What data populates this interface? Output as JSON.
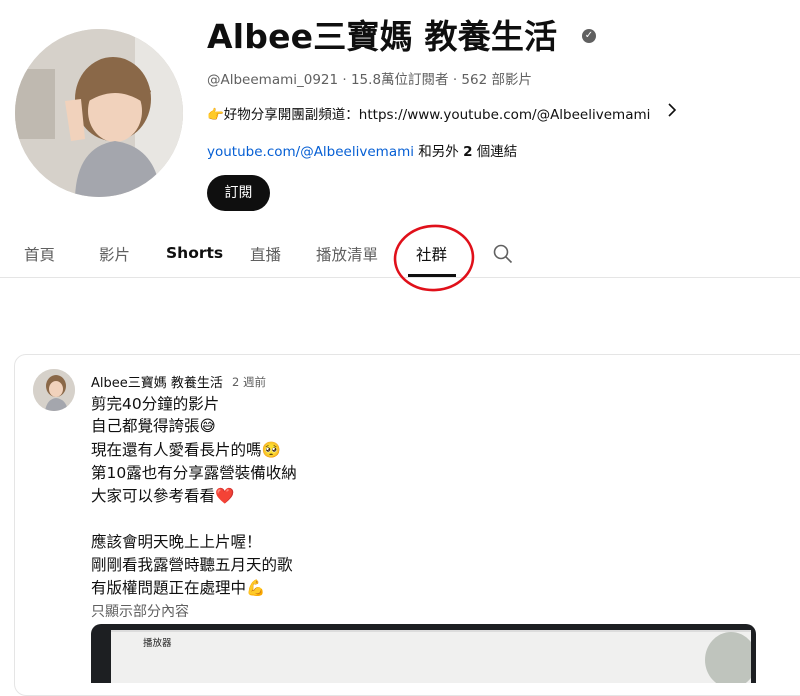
{
  "channel": {
    "name": "Albee三寶媽 教養生活",
    "meta": "@Albeemami_0921 · 15.8萬位訂閱者 · 562 部影片",
    "description": "👉好物分享開團副頻道：https://www.youtube.com/@Albeelivemami",
    "links": {
      "link_text": "youtube.com/@Albeelivemami",
      "middle_text": " 和另外 ",
      "count": "2",
      "suffix": " 個連結"
    },
    "subscribe_label": "訂閱"
  },
  "tabs": [
    {
      "label": "首頁"
    },
    {
      "label": "影片"
    },
    {
      "label": "Shorts"
    },
    {
      "label": "直播"
    },
    {
      "label": "播放清單"
    },
    {
      "label": "社群"
    }
  ],
  "active_tab": "社群",
  "post": {
    "author": "Albee三寶媽 教養生活",
    "time": "2 週前",
    "lines": [
      "剪完40分鐘的影片",
      "自己都覺得誇張😅",
      "現在還有人愛看長片的嗎🥺",
      "第10露也有分享露營裝備收納",
      "大家可以參考看看❤️",
      "",
      "應該會明天晚上上片喔！",
      "剛剛看我露營時聽五月天的歌",
      "有版權問題正在處理中💪"
    ],
    "show_less": "只顯示部分內容",
    "image_label": "播放器"
  },
  "colors": {
    "link": "#065fd4",
    "secondary_text": "#606060",
    "annotation_circle": "#e0101a"
  }
}
